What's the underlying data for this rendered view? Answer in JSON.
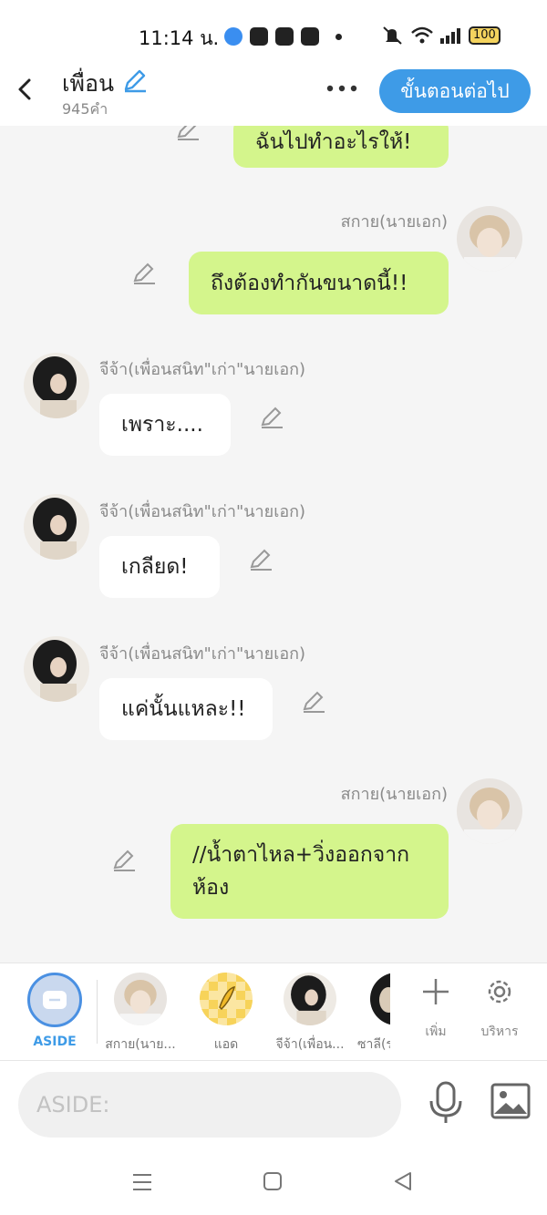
{
  "status_bar": {
    "time": "11:14 น.",
    "battery": "100"
  },
  "header": {
    "title": "เพื่อน",
    "word_count": "945คำ",
    "next_button": "ขั้นตอนต่อไป"
  },
  "messages": [
    {
      "sender": "",
      "text": "ฉันไปทำอะไรให้!",
      "side": "right"
    },
    {
      "sender": "สกาย(นายเอก)",
      "text": "ถึงต้องทำกันขนาดนี้!!",
      "side": "right"
    },
    {
      "sender": "จีจ้า(เพื่อนสนิท\"เก่า\"นายเอก)",
      "text": "เพราะ....",
      "side": "left"
    },
    {
      "sender": "จีจ้า(เพื่อนสนิท\"เก่า\"นายเอก)",
      "text": "เกลียด!",
      "side": "left"
    },
    {
      "sender": "จีจ้า(เพื่อนสนิท\"เก่า\"นายเอก)",
      "text": "แค่นั้นแหละ!!",
      "side": "left"
    },
    {
      "sender": "สกาย(นายเอก)",
      "text": "//น้ำตาไหล+วิ่งออกจากห้อง",
      "side": "right"
    }
  ],
  "member_bar": {
    "aside_label": "ASIDE",
    "members": [
      "สกาย(นาย...",
      "แอด",
      "จีจ้า(เพื่อน...",
      "ซาลี(ร"
    ],
    "add_label": "เพิ่ม",
    "manage_label": "บริหาร"
  },
  "input": {
    "placeholder": "ASIDE:"
  },
  "colors": {
    "accent": "#3e9be7",
    "my_bubble": "#d4f58c",
    "their_bubble": "#ffffff",
    "background": "#f5f5f5"
  }
}
